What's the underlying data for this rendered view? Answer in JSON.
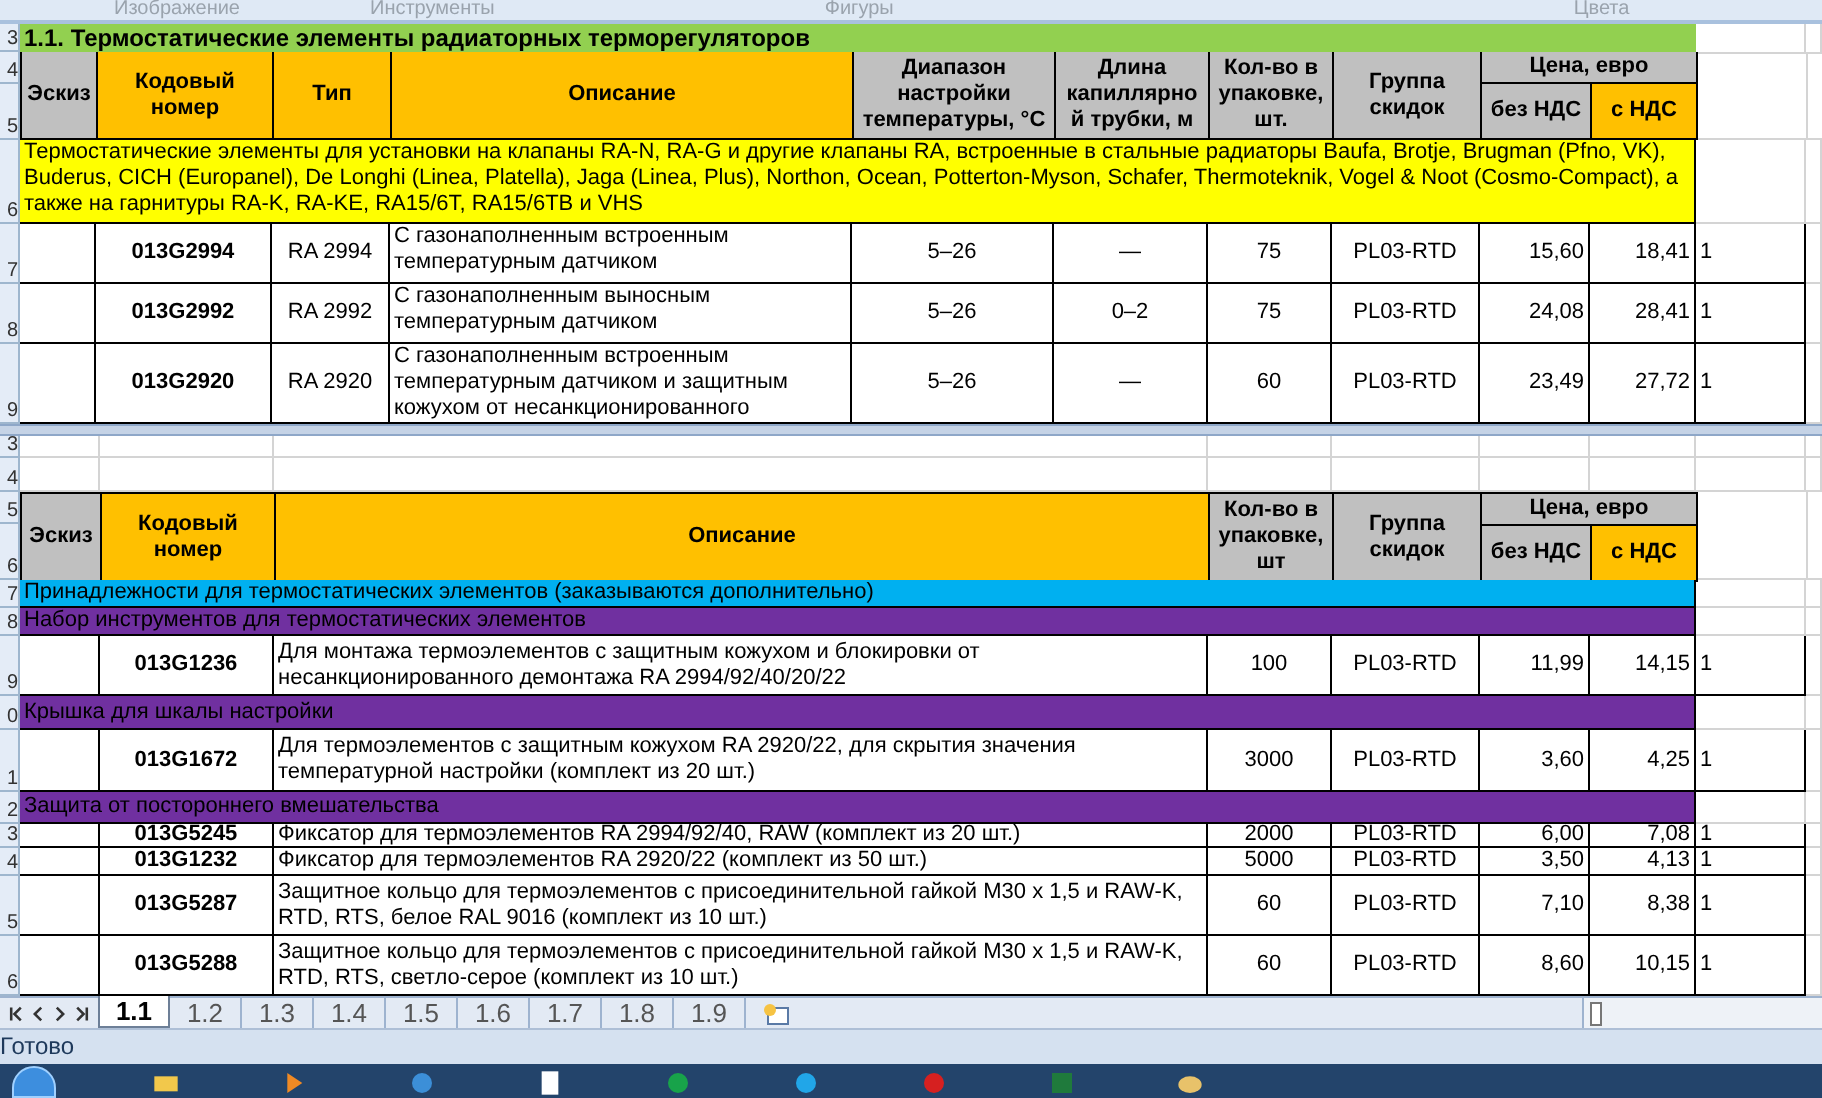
{
  "ribbon_group_labels": [
    "Изображение",
    "Инструменты",
    "Фигуры",
    "Цвета"
  ],
  "top_pane": {
    "row_numbers": [
      "3",
      "4",
      "5",
      "6",
      "7",
      "8",
      "9"
    ],
    "title": "1.1. Термостатические элементы радиаторных терморегуляторов",
    "header": [
      {
        "label": "Эскиз",
        "color": "#c0c0c0"
      },
      {
        "label": "Кодовый номер",
        "color": "#ffc000"
      },
      {
        "label": "Тип",
        "color": "#ffc000"
      },
      {
        "label": "Описание",
        "color": "#ffc000"
      },
      {
        "label": "Диапазон настройки температуры, °С",
        "color": "#c0c0c0"
      },
      {
        "label": "Длина капиллярно й трубки, м",
        "color": "#c0c0c0"
      },
      {
        "label": "Кол-во в упаковке, шт.",
        "color": "#c0c0c0"
      },
      {
        "label": "Группа скидок",
        "color": "#c0c0c0"
      },
      {
        "label": "Цена, евро",
        "color": "#c0c0c0",
        "children": [
          {
            "label": "без НДС",
            "color": "#c0c0c0"
          },
          {
            "label": "с НДС",
            "color": "#ffc000"
          }
        ]
      }
    ],
    "note": "Термостатические элементы для установки на клапаны RA-N, RA-G и другие клапаны  RA, встроенные в стальные радиаторы Baufa, Brotje, Brugman (Pfno, VK), Buderus, CICH (Europanel), De Longhi (Linea, Platella), Jaga (Linea, Plus), Northon, Ocean, Potterton-Myson, Schafer, Thermoteknik, Vogel & Noot (Cosmo-Compact), а также на гарнитуры RA-K, RA-KE, RA15/6T, RA15/6TB и VHS",
    "rows": [
      {
        "code": "013G2994",
        "type": "RA 2994",
        "description": "С газонаполненным встроенным температурным датчиком",
        "range": "5–26",
        "capillary": "—",
        "qty": "75",
        "group": "PL03-RTD",
        "price_net": "15,60",
        "price_vat": "18,41",
        "column_12": "1"
      },
      {
        "code": "013G2992",
        "type": "RA 2992",
        "description": "С газонаполненным выносным температурным датчиком",
        "range": "5–26",
        "capillary": "0–2",
        "qty": "75",
        "group": "PL03-RTD",
        "price_net": "24,08",
        "price_vat": "28,41",
        "column_12": "1"
      },
      {
        "code": "013G2920",
        "type": "RA 2920",
        "description": "С газонаполненным встроенным температурным датчиком и защитным кожухом от несанкционированного",
        "range": "5–26",
        "capillary": "—",
        "qty": "60",
        "group": "PL03-RTD",
        "price_net": "23,49",
        "price_vat": "27,72",
        "column_12": "1"
      }
    ]
  },
  "bottom_pane": {
    "row_numbers": [
      "3",
      "4",
      "5",
      "6",
      "7",
      "8",
      "9",
      "0",
      "1",
      "2",
      "3",
      "4",
      "5",
      "6"
    ],
    "header": [
      {
        "label": "Эскиз",
        "color": "#c0c0c0"
      },
      {
        "label": "Кодовый номер",
        "color": "#ffc000"
      },
      {
        "label": "Описание",
        "color": "#ffc000"
      },
      {
        "label": "Кол-во в упаковке, шт",
        "color": "#c0c0c0"
      },
      {
        "label": "Группа скидок",
        "color": "#c0c0c0"
      },
      {
        "label": "Цена, евро",
        "color": "#c0c0c0",
        "children": [
          {
            "label": "без НДС",
            "color": "#c0c0c0"
          },
          {
            "label": "с НДС",
            "color": "#ffc000"
          }
        ]
      }
    ],
    "rows": [
      {
        "kind": "section",
        "text": "Принадлежности для термостатических элементов (заказываются дополнительно)",
        "color": "#00b0f0"
      },
      {
        "kind": "section",
        "text": "Набор инструментов для термостатических элементов",
        "color": "#7030a0"
      },
      {
        "kind": "item",
        "code": "013G1236",
        "description": "Для монтажа термоэлементов с защитным кожухом и блокировки от несанкционированного демонтажа RA 2994/92/40/20/22",
        "qty": "100",
        "group": "PL03-RTD",
        "price_net": "11,99",
        "price_vat": "14,15",
        "column_9": "1"
      },
      {
        "kind": "section",
        "text": "Крышка для шкалы настройки",
        "color": "#7030a0"
      },
      {
        "kind": "item",
        "code": "013G1672",
        "description": "Для термоэлементов с защитным кожухом RA 2920/22, для скрытия значения температурной настройки (комплект из 20 шт.)",
        "qty": "3000",
        "group": "PL03-RTD",
        "price_net": "3,60",
        "price_vat": "4,25",
        "column_9": "1"
      },
      {
        "kind": "section",
        "text": "Защита от постороннего вмешательства",
        "color": "#7030a0"
      },
      {
        "kind": "item",
        "code": "013G5245",
        "description": "Фиксатор для термоэлементов RA 2994/92/40, RAW (комплект из 20 шт.)",
        "qty": "2000",
        "group": "PL03-RTD",
        "price_net": "6,00",
        "price_vat": "7,08",
        "column_9": "1"
      },
      {
        "kind": "item",
        "code": "013G1232",
        "description": "Фиксатор для термоэлементов RA 2920/22 (комплект из 50 шт.)",
        "qty": "5000",
        "group": "PL03-RTD",
        "price_net": "3,50",
        "price_vat": "4,13",
        "column_9": "1"
      },
      {
        "kind": "item",
        "code": "013G5287",
        "description": "Защитное кольцо для термоэлементов с присоединительной гайкой M30 x 1,5 и RAW-K, RTD, RTS, белое RAL 9016 (комплект из 10 шт.)",
        "qty": "60",
        "group": "PL03-RTD",
        "price_net": "7,10",
        "price_vat": "8,38",
        "column_9": "1"
      },
      {
        "kind": "item",
        "code": "013G5288",
        "description": "Защитное кольцо для термоэлементов с присоединительной гайкой M30 x 1,5 и RAW-K, RTD, RTS, светло-серое (комплект из 10 шт.)",
        "qty": "60",
        "group": "PL03-RTD",
        "price_net": "8,60",
        "price_vat": "10,15",
        "column_9": "1"
      }
    ]
  },
  "sheet_tabs": [
    {
      "label": "1.1",
      "selected": true
    },
    {
      "label": "1.2",
      "selected": false
    },
    {
      "label": "1.3",
      "selected": false
    },
    {
      "label": "1.4",
      "selected": false
    },
    {
      "label": "1.5",
      "selected": false
    },
    {
      "label": "1.6",
      "selected": false
    },
    {
      "label": "1.7",
      "selected": false
    },
    {
      "label": "1.8",
      "selected": false
    },
    {
      "label": "1.9",
      "selected": false
    }
  ],
  "status_bar": "Готово"
}
